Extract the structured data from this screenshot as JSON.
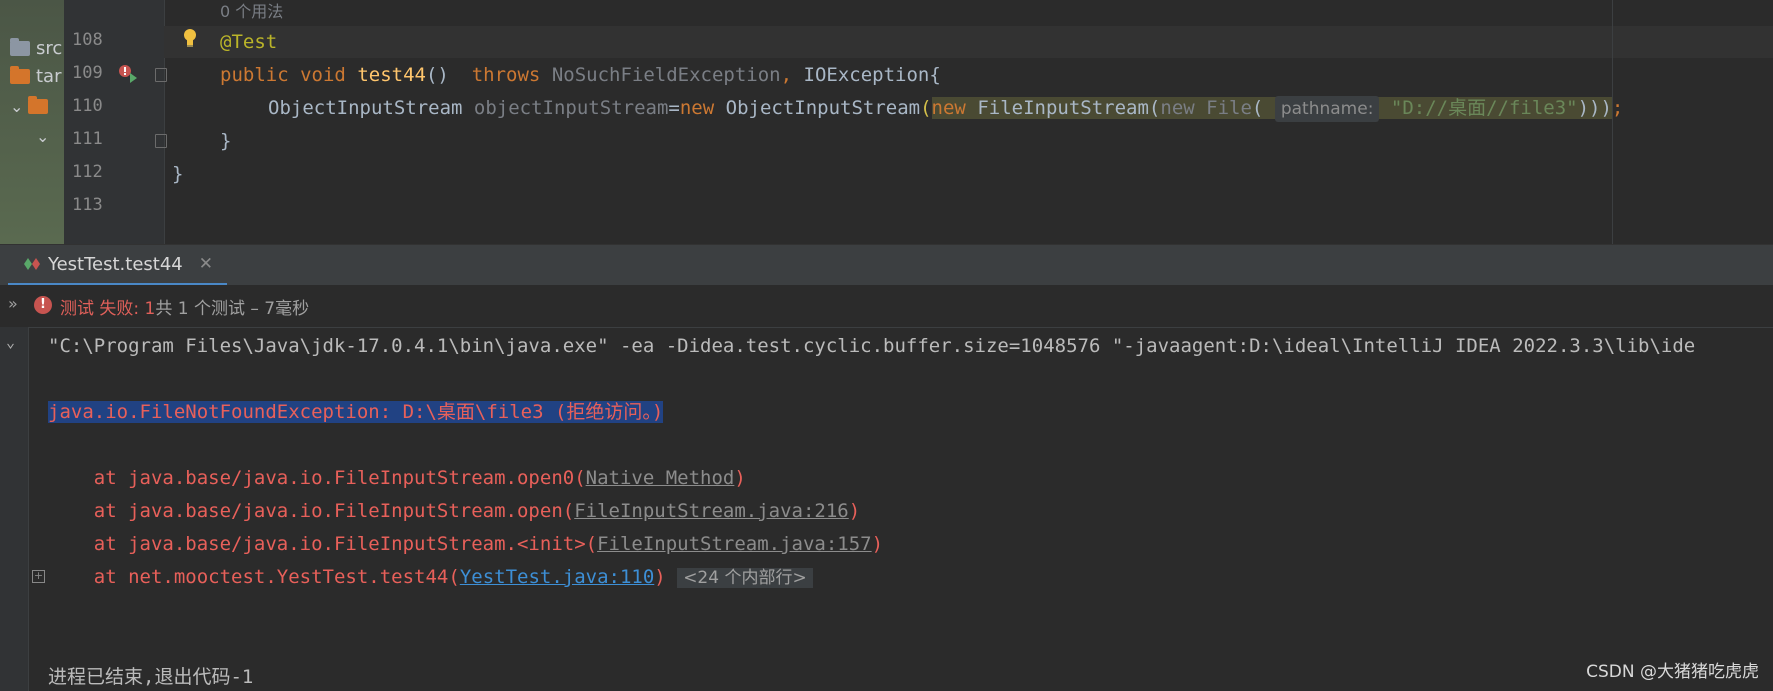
{
  "project_tree": {
    "items": [
      {
        "label": "src",
        "icon": "folder-icon-grey"
      },
      {
        "label": "tar",
        "icon": "folder-icon-orange"
      },
      {
        "label": "",
        "icon": "folder-icon-orange"
      },
      {
        "label": "",
        "icon": "chevron-down-icon"
      }
    ]
  },
  "editor": {
    "usage_hint": "0 个用法",
    "line_numbers": [
      "108",
      "109",
      "110",
      "111",
      "112",
      "113"
    ],
    "lines": {
      "l108": {
        "annotation": "@Test"
      },
      "l109": {
        "kw_public": "public",
        "kw_void": "void",
        "method": "test44",
        "parens": "()",
        "kw_throws": "throws",
        "exc1": "NoSuchFieldException",
        "comma": ",",
        "exc2": "IOException",
        "brace": "{"
      },
      "l110": {
        "type1": "ObjectInputStream",
        "var": "objectInputStream",
        "eq": "=",
        "kw_new1": "new",
        "type2": "ObjectInputStream",
        "open": "(",
        "kw_new2": "new",
        "type3": "FileInputStream",
        "open2": "(",
        "kw_new3": "new",
        "type4": "File",
        "open3": "(",
        "param_hint": "pathname:",
        "string": "\"D://桌面//file3\"",
        "close": ")))",
        "semi": ";"
      },
      "l111": {
        "brace": "}"
      },
      "l112": {
        "brace": "}"
      }
    }
  },
  "run_panel": {
    "tab_label": "YestTest.test44",
    "status": {
      "failed_label": "测试 失败:",
      "failed_count": "1",
      "summary": "共 1 个测试 – 7毫秒"
    },
    "console": {
      "command": "\"C:\\Program Files\\Java\\jdk-17.0.4.1\\bin\\java.exe\" -ea -Didea.test.cyclic.buffer.size=1048576 \"-javaagent:D:\\ideal\\IntelliJ IDEA 2022.3.3\\lib\\ide",
      "exception": "java.io.FileNotFoundException: D:\\桌面\\file3 (拒绝访问。)",
      "frames": [
        {
          "prefix": "    at java.base/java.io.FileInputStream.open0(",
          "link": "Native Method",
          "suffix": ")"
        },
        {
          "prefix": "    at java.base/java.io.FileInputStream.open(",
          "link": "FileInputStream.java:216",
          "suffix": ")"
        },
        {
          "prefix": "    at java.base/java.io.FileInputStream.<init>(",
          "link": "FileInputStream.java:157",
          "suffix": ")"
        },
        {
          "prefix": "    at net.mooctest.YestTest.test44(",
          "link": "YestTest.java:110",
          "suffix": ")"
        }
      ],
      "internal_frames": "<24 个内部行>",
      "exit_message": "进程已结束,退出代码-1"
    }
  },
  "watermark": "CSDN @大猪猪吃虎虎",
  "colors": {
    "background": "#2b2b2b",
    "keyword": "#cc7832",
    "method": "#ffc66d",
    "annotation": "#bbb529",
    "string": "#6a8759",
    "error": "#e8605a",
    "selection": "#214283",
    "link": "#3d8fd6"
  }
}
